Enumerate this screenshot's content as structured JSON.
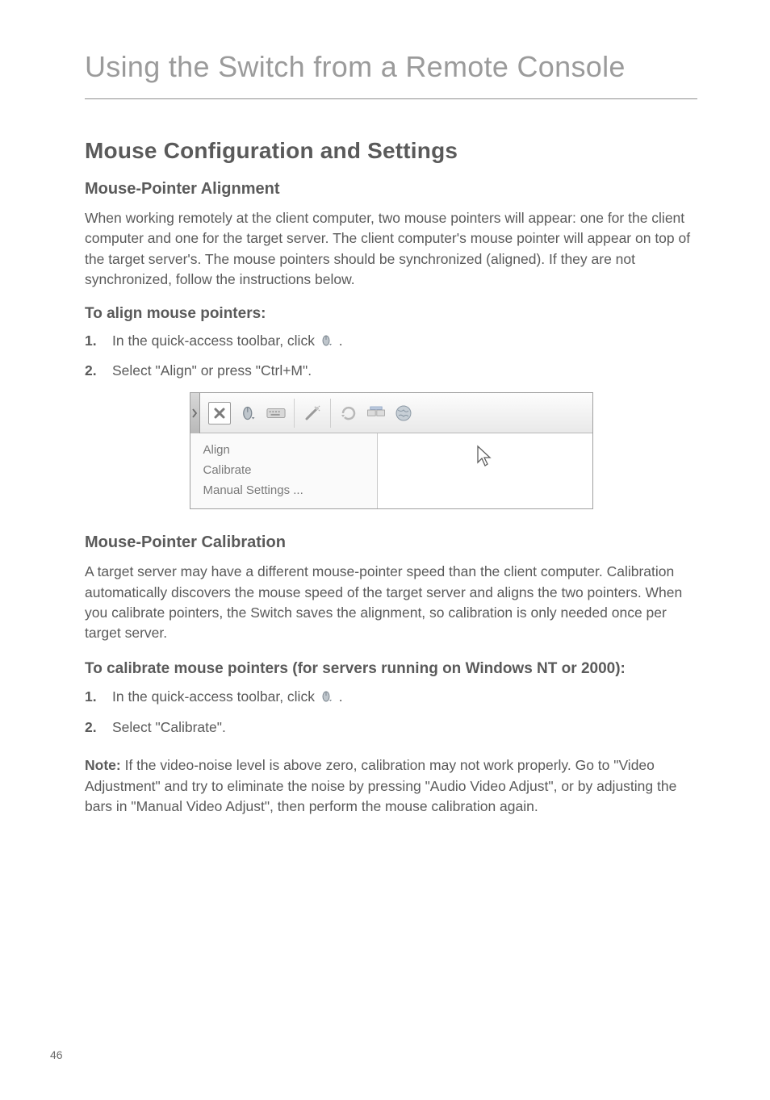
{
  "chapter": {
    "title": "Using the Switch from a Remote Console"
  },
  "section": {
    "title": "Mouse Configuration and Settings"
  },
  "alignment": {
    "heading": "Mouse-Pointer Alignment",
    "body": "When working remotely at the client computer, two mouse pointers will appear: one for the client computer and one for the target server. The client computer's mouse pointer will appear on top of the target server's. The mouse pointers should be synchronized (aligned). If they are not synchronized, follow the instructions below.",
    "howto_heading": "To align mouse pointers:",
    "step1_num": "1.",
    "step1_pre": "In the quick-access toolbar, click ",
    "step1_post": ".",
    "step2_num": "2.",
    "step2": "Select \"Align\" or press \"Ctrl+M\"."
  },
  "toolbar_menu": {
    "item1": "Align",
    "item2": "Calibrate",
    "item3": "Manual Settings ..."
  },
  "calibration": {
    "heading": "Mouse-Pointer Calibration",
    "body": "A target server may have a different mouse-pointer speed than the client computer. Calibration automatically discovers the mouse speed of the target server and aligns the two pointers. When you calibrate pointers, the Switch saves the alignment, so calibration is only needed once per target server.",
    "howto_heading": "To calibrate mouse pointers (for servers running on Windows NT or 2000):",
    "step1_num": "1.",
    "step1_pre": "In the quick-access toolbar, click ",
    "step1_post": ".",
    "step2_num": "2.",
    "step2": "Select \"Calibrate\"."
  },
  "note": {
    "label": "Note: ",
    "body": "If the video-noise level is above zero, calibration may not work properly. Go to \"Video Adjustment\" and try to eliminate the noise by pressing \"Audio Video Adjust\", or by adjusting the bars in \"Manual Video Adjust\", then perform the mouse calibration again."
  },
  "page_number": "46",
  "icons": {
    "mouse_icon": "mouse-settings-icon"
  }
}
